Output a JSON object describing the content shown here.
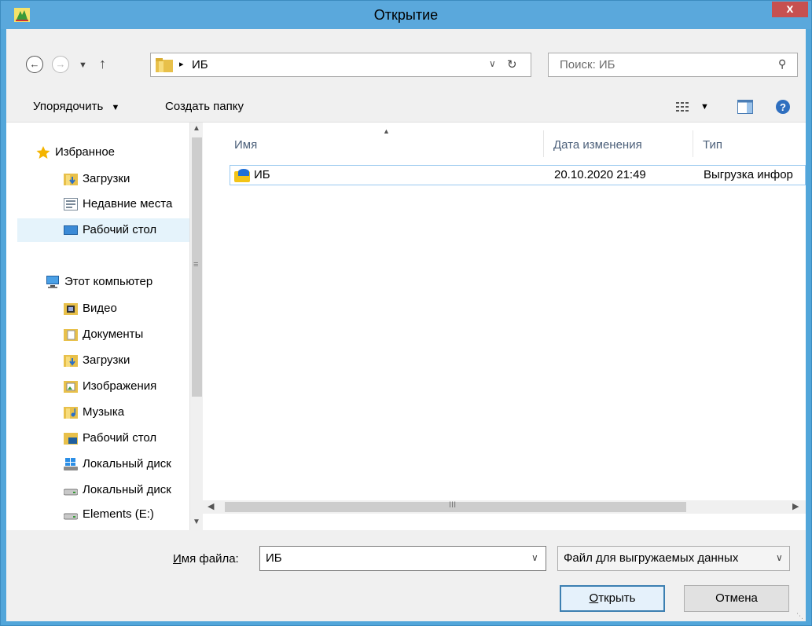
{
  "window": {
    "title": "Открытие",
    "close_label": "x",
    "accent": "#5aa8dc"
  },
  "nav": {
    "back_icon": "arrow-left-icon",
    "forward_icon": "arrow-right-icon",
    "up_icon": "arrow-up-icon",
    "path_separator": "▸",
    "path": "ИБ",
    "search_placeholder": "Поиск: ИБ"
  },
  "toolbar": {
    "organize_label": "Упорядочить",
    "new_folder_label": "Создать папку"
  },
  "sidebar": {
    "items": [
      {
        "label": "Избранное",
        "icon": "star-icon"
      },
      {
        "label": "Загрузки",
        "icon": "downloads-folder-icon"
      },
      {
        "label": "Недавние места",
        "icon": "recent-places-icon"
      },
      {
        "label": "Рабочий стол",
        "icon": "desktop-icon"
      },
      {
        "label": "Этот компьютер",
        "icon": "computer-icon"
      },
      {
        "label": "Видео",
        "icon": "video-folder-icon"
      },
      {
        "label": "Документы",
        "icon": "documents-folder-icon"
      },
      {
        "label": "Загрузки",
        "icon": "downloads-folder-icon"
      },
      {
        "label": "Изображения",
        "icon": "pictures-folder-icon"
      },
      {
        "label": "Музыка",
        "icon": "music-folder-icon"
      },
      {
        "label": "Рабочий стол",
        "icon": "desktop-folder-icon"
      },
      {
        "label": "Локальный диск",
        "icon": "windows-drive-icon"
      },
      {
        "label": "Локальный диск",
        "icon": "drive-icon"
      },
      {
        "label": "Elements (E:)",
        "icon": "drive-icon"
      }
    ],
    "selected": "Рабочий стол"
  },
  "filelist": {
    "columns": [
      "Имя",
      "Дата изменения",
      "Тип"
    ],
    "rows": [
      {
        "name": "ИБ",
        "date": "20.10.2020 21:49",
        "type": "Выгрузка инфор"
      }
    ]
  },
  "footer": {
    "filename_label_underline": "И",
    "filename_label_rest": "мя файла:",
    "filename_value": "ИБ",
    "filetype_value": "Файл для выгружаемых данных",
    "open_underline": "О",
    "open_rest": "ткрыть",
    "cancel_label": "Отмена"
  }
}
